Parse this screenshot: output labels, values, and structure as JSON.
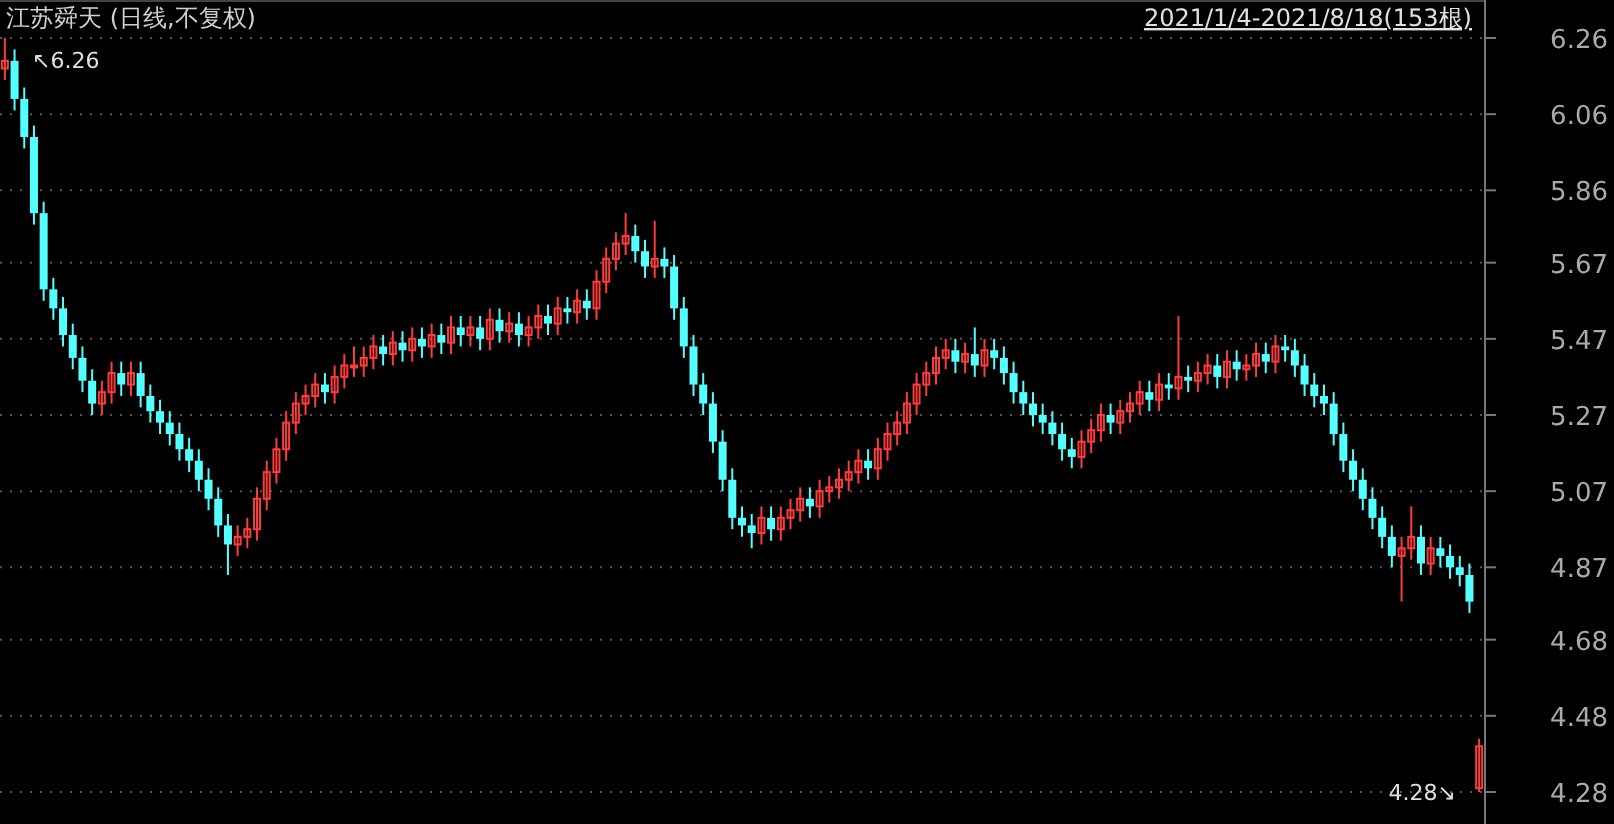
{
  "chart": {
    "title": "江苏舜天 (日线,不复权)",
    "date_range": "2021/1/4-2021/8/18(153根)",
    "high_label": "↖6.26",
    "low_label": "4.28↘",
    "chart_data": {
      "type": "candlestick",
      "grid": true,
      "ylim": [
        4.28,
        6.26
      ],
      "yticks": [
        {
          "value": 6.26,
          "label": "6.26"
        },
        {
          "value": 6.06,
          "label": "6.06"
        },
        {
          "value": 5.86,
          "label": "5.86"
        },
        {
          "value": 5.67,
          "label": "5.67"
        },
        {
          "value": 5.47,
          "label": "5.47"
        },
        {
          "value": 5.27,
          "label": "5.27"
        },
        {
          "value": 5.07,
          "label": "5.07"
        },
        {
          "value": 4.87,
          "label": "4.87"
        },
        {
          "value": 4.68,
          "label": "4.68"
        },
        {
          "value": 4.48,
          "label": "4.48"
        },
        {
          "value": 4.28,
          "label": "4.28"
        }
      ],
      "ohlc": [
        [
          6.18,
          6.26,
          6.15,
          6.2
        ],
        [
          6.2,
          6.23,
          6.07,
          6.1
        ],
        [
          6.1,
          6.13,
          5.97,
          6.0
        ],
        [
          6.0,
          6.03,
          5.77,
          5.8
        ],
        [
          5.8,
          5.83,
          5.57,
          5.6
        ],
        [
          5.6,
          5.63,
          5.52,
          5.55
        ],
        [
          5.55,
          5.58,
          5.45,
          5.48
        ],
        [
          5.48,
          5.51,
          5.39,
          5.42
        ],
        [
          5.42,
          5.45,
          5.33,
          5.36
        ],
        [
          5.36,
          5.39,
          5.27,
          5.3
        ],
        [
          5.3,
          5.36,
          5.27,
          5.33
        ],
        [
          5.33,
          5.41,
          5.3,
          5.38
        ],
        [
          5.38,
          5.41,
          5.32,
          5.35
        ],
        [
          5.35,
          5.41,
          5.32,
          5.38
        ],
        [
          5.38,
          5.41,
          5.29,
          5.32
        ],
        [
          5.32,
          5.35,
          5.25,
          5.28
        ],
        [
          5.28,
          5.31,
          5.22,
          5.25
        ],
        [
          5.25,
          5.28,
          5.19,
          5.22
        ],
        [
          5.22,
          5.25,
          5.15,
          5.18
        ],
        [
          5.18,
          5.21,
          5.12,
          5.15
        ],
        [
          5.15,
          5.18,
          5.07,
          5.1
        ],
        [
          5.1,
          5.13,
          5.02,
          5.05
        ],
        [
          5.05,
          5.08,
          4.95,
          4.98
        ],
        [
          4.98,
          5.01,
          4.85,
          4.93
        ],
        [
          4.93,
          4.98,
          4.9,
          4.95
        ],
        [
          4.95,
          5.0,
          4.92,
          4.97
        ],
        [
          4.97,
          5.08,
          4.94,
          5.05
        ],
        [
          5.05,
          5.15,
          5.02,
          5.12
        ],
        [
          5.12,
          5.21,
          5.09,
          5.18
        ],
        [
          5.18,
          5.28,
          5.15,
          5.25
        ],
        [
          5.25,
          5.33,
          5.22,
          5.3
        ],
        [
          5.3,
          5.35,
          5.27,
          5.32
        ],
        [
          5.32,
          5.38,
          5.29,
          5.35
        ],
        [
          5.35,
          5.38,
          5.3,
          5.33
        ],
        [
          5.33,
          5.4,
          5.3,
          5.37
        ],
        [
          5.37,
          5.43,
          5.34,
          5.4
        ],
        [
          5.4,
          5.45,
          5.37,
          5.4
        ],
        [
          5.4,
          5.45,
          5.37,
          5.42
        ],
        [
          5.42,
          5.48,
          5.39,
          5.45
        ],
        [
          5.45,
          5.48,
          5.4,
          5.43
        ],
        [
          5.43,
          5.49,
          5.4,
          5.46
        ],
        [
          5.46,
          5.49,
          5.41,
          5.44
        ],
        [
          5.44,
          5.5,
          5.41,
          5.47
        ],
        [
          5.47,
          5.5,
          5.42,
          5.45
        ],
        [
          5.45,
          5.51,
          5.42,
          5.48
        ],
        [
          5.48,
          5.51,
          5.43,
          5.46
        ],
        [
          5.46,
          5.53,
          5.43,
          5.5
        ],
        [
          5.5,
          5.53,
          5.45,
          5.48
        ],
        [
          5.48,
          5.53,
          5.45,
          5.5
        ],
        [
          5.5,
          5.53,
          5.44,
          5.47
        ],
        [
          5.47,
          5.55,
          5.44,
          5.52
        ],
        [
          5.52,
          5.55,
          5.46,
          5.49
        ],
        [
          5.49,
          5.54,
          5.46,
          5.51
        ],
        [
          5.51,
          5.54,
          5.45,
          5.48
        ],
        [
          5.48,
          5.53,
          5.45,
          5.5
        ],
        [
          5.5,
          5.56,
          5.47,
          5.53
        ],
        [
          5.53,
          5.56,
          5.48,
          5.51
        ],
        [
          5.51,
          5.58,
          5.48,
          5.55
        ],
        [
          5.55,
          5.58,
          5.51,
          5.54
        ],
        [
          5.54,
          5.6,
          5.51,
          5.57
        ],
        [
          5.57,
          5.6,
          5.52,
          5.55
        ],
        [
          5.55,
          5.65,
          5.52,
          5.62
        ],
        [
          5.62,
          5.71,
          5.59,
          5.68
        ],
        [
          5.68,
          5.75,
          5.65,
          5.72
        ],
        [
          5.72,
          5.8,
          5.69,
          5.74
        ],
        [
          5.74,
          5.77,
          5.67,
          5.7
        ],
        [
          5.7,
          5.73,
          5.63,
          5.66
        ],
        [
          5.66,
          5.78,
          5.63,
          5.68
        ],
        [
          5.68,
          5.71,
          5.63,
          5.66
        ],
        [
          5.66,
          5.69,
          5.52,
          5.55
        ],
        [
          5.55,
          5.58,
          5.42,
          5.45
        ],
        [
          5.45,
          5.48,
          5.32,
          5.35
        ],
        [
          5.35,
          5.38,
          5.27,
          5.3
        ],
        [
          5.3,
          5.33,
          5.17,
          5.2
        ],
        [
          5.2,
          5.23,
          5.07,
          5.1
        ],
        [
          5.1,
          5.13,
          4.97,
          5.0
        ],
        [
          5.0,
          5.03,
          4.95,
          4.98
        ],
        [
          4.98,
          5.01,
          4.92,
          4.96
        ],
        [
          4.96,
          5.03,
          4.93,
          5.0
        ],
        [
          5.0,
          5.03,
          4.94,
          4.97
        ],
        [
          4.97,
          5.03,
          4.94,
          5.0
        ],
        [
          5.0,
          5.05,
          4.97,
          5.02
        ],
        [
          5.02,
          5.08,
          4.99,
          5.05
        ],
        [
          5.05,
          5.08,
          5.0,
          5.03
        ],
        [
          5.03,
          5.1,
          5.0,
          5.07
        ],
        [
          5.07,
          5.11,
          5.04,
          5.08
        ],
        [
          5.08,
          5.13,
          5.05,
          5.1
        ],
        [
          5.1,
          5.15,
          5.07,
          5.12
        ],
        [
          5.12,
          5.18,
          5.09,
          5.15
        ],
        [
          5.15,
          5.18,
          5.1,
          5.13
        ],
        [
          5.13,
          5.21,
          5.1,
          5.18
        ],
        [
          5.18,
          5.25,
          5.15,
          5.22
        ],
        [
          5.22,
          5.28,
          5.19,
          5.25
        ],
        [
          5.25,
          5.33,
          5.22,
          5.3
        ],
        [
          5.3,
          5.38,
          5.27,
          5.35
        ],
        [
          5.35,
          5.41,
          5.32,
          5.38
        ],
        [
          5.38,
          5.45,
          5.35,
          5.42
        ],
        [
          5.42,
          5.47,
          5.39,
          5.44
        ],
        [
          5.44,
          5.47,
          5.38,
          5.41
        ],
        [
          5.41,
          5.46,
          5.38,
          5.43
        ],
        [
          5.43,
          5.5,
          5.37,
          5.4
        ],
        [
          5.4,
          5.47,
          5.37,
          5.44
        ],
        [
          5.44,
          5.47,
          5.39,
          5.42
        ],
        [
          5.42,
          5.45,
          5.35,
          5.38
        ],
        [
          5.38,
          5.41,
          5.3,
          5.33
        ],
        [
          5.33,
          5.36,
          5.27,
          5.3
        ],
        [
          5.3,
          5.33,
          5.24,
          5.27
        ],
        [
          5.27,
          5.3,
          5.22,
          5.25
        ],
        [
          5.25,
          5.28,
          5.19,
          5.22
        ],
        [
          5.22,
          5.25,
          5.15,
          5.18
        ],
        [
          5.18,
          5.21,
          5.13,
          5.16
        ],
        [
          5.16,
          5.23,
          5.13,
          5.2
        ],
        [
          5.2,
          5.26,
          5.17,
          5.23
        ],
        [
          5.23,
          5.3,
          5.2,
          5.27
        ],
        [
          5.27,
          5.3,
          5.22,
          5.25
        ],
        [
          5.25,
          5.31,
          5.22,
          5.28
        ],
        [
          5.28,
          5.33,
          5.25,
          5.3
        ],
        [
          5.3,
          5.36,
          5.27,
          5.33
        ],
        [
          5.33,
          5.36,
          5.28,
          5.31
        ],
        [
          5.31,
          5.38,
          5.28,
          5.35
        ],
        [
          5.35,
          5.38,
          5.31,
          5.34
        ],
        [
          5.34,
          5.53,
          5.31,
          5.37
        ],
        [
          5.37,
          5.4,
          5.33,
          5.36
        ],
        [
          5.36,
          5.41,
          5.33,
          5.38
        ],
        [
          5.38,
          5.43,
          5.35,
          5.4
        ],
        [
          5.4,
          5.43,
          5.34,
          5.37
        ],
        [
          5.37,
          5.44,
          5.34,
          5.41
        ],
        [
          5.41,
          5.44,
          5.36,
          5.39
        ],
        [
          5.39,
          5.43,
          5.36,
          5.4
        ],
        [
          5.4,
          5.46,
          5.37,
          5.43
        ],
        [
          5.43,
          5.46,
          5.38,
          5.41
        ],
        [
          5.41,
          5.48,
          5.38,
          5.45
        ],
        [
          5.45,
          5.48,
          5.41,
          5.44
        ],
        [
          5.44,
          5.47,
          5.37,
          5.4
        ],
        [
          5.4,
          5.43,
          5.32,
          5.35
        ],
        [
          5.35,
          5.38,
          5.29,
          5.32
        ],
        [
          5.32,
          5.35,
          5.27,
          5.3
        ],
        [
          5.3,
          5.33,
          5.19,
          5.22
        ],
        [
          5.22,
          5.25,
          5.12,
          5.15
        ],
        [
          5.15,
          5.18,
          5.07,
          5.1
        ],
        [
          5.1,
          5.13,
          5.02,
          5.05
        ],
        [
          5.05,
          5.08,
          4.97,
          5.0
        ],
        [
          5.0,
          5.03,
          4.92,
          4.95
        ],
        [
          4.95,
          4.98,
          4.87,
          4.9
        ],
        [
          4.9,
          4.95,
          4.78,
          4.92
        ],
        [
          4.92,
          5.03,
          4.89,
          4.95
        ],
        [
          4.95,
          4.98,
          4.85,
          4.88
        ],
        [
          4.88,
          4.95,
          4.85,
          4.92
        ],
        [
          4.92,
          4.95,
          4.87,
          4.9
        ],
        [
          4.9,
          4.93,
          4.84,
          4.87
        ],
        [
          4.87,
          4.9,
          4.82,
          4.85
        ],
        [
          4.85,
          4.88,
          4.75,
          4.78
        ],
        [
          4.29,
          4.42,
          4.28,
          4.4
        ]
      ]
    }
  }
}
